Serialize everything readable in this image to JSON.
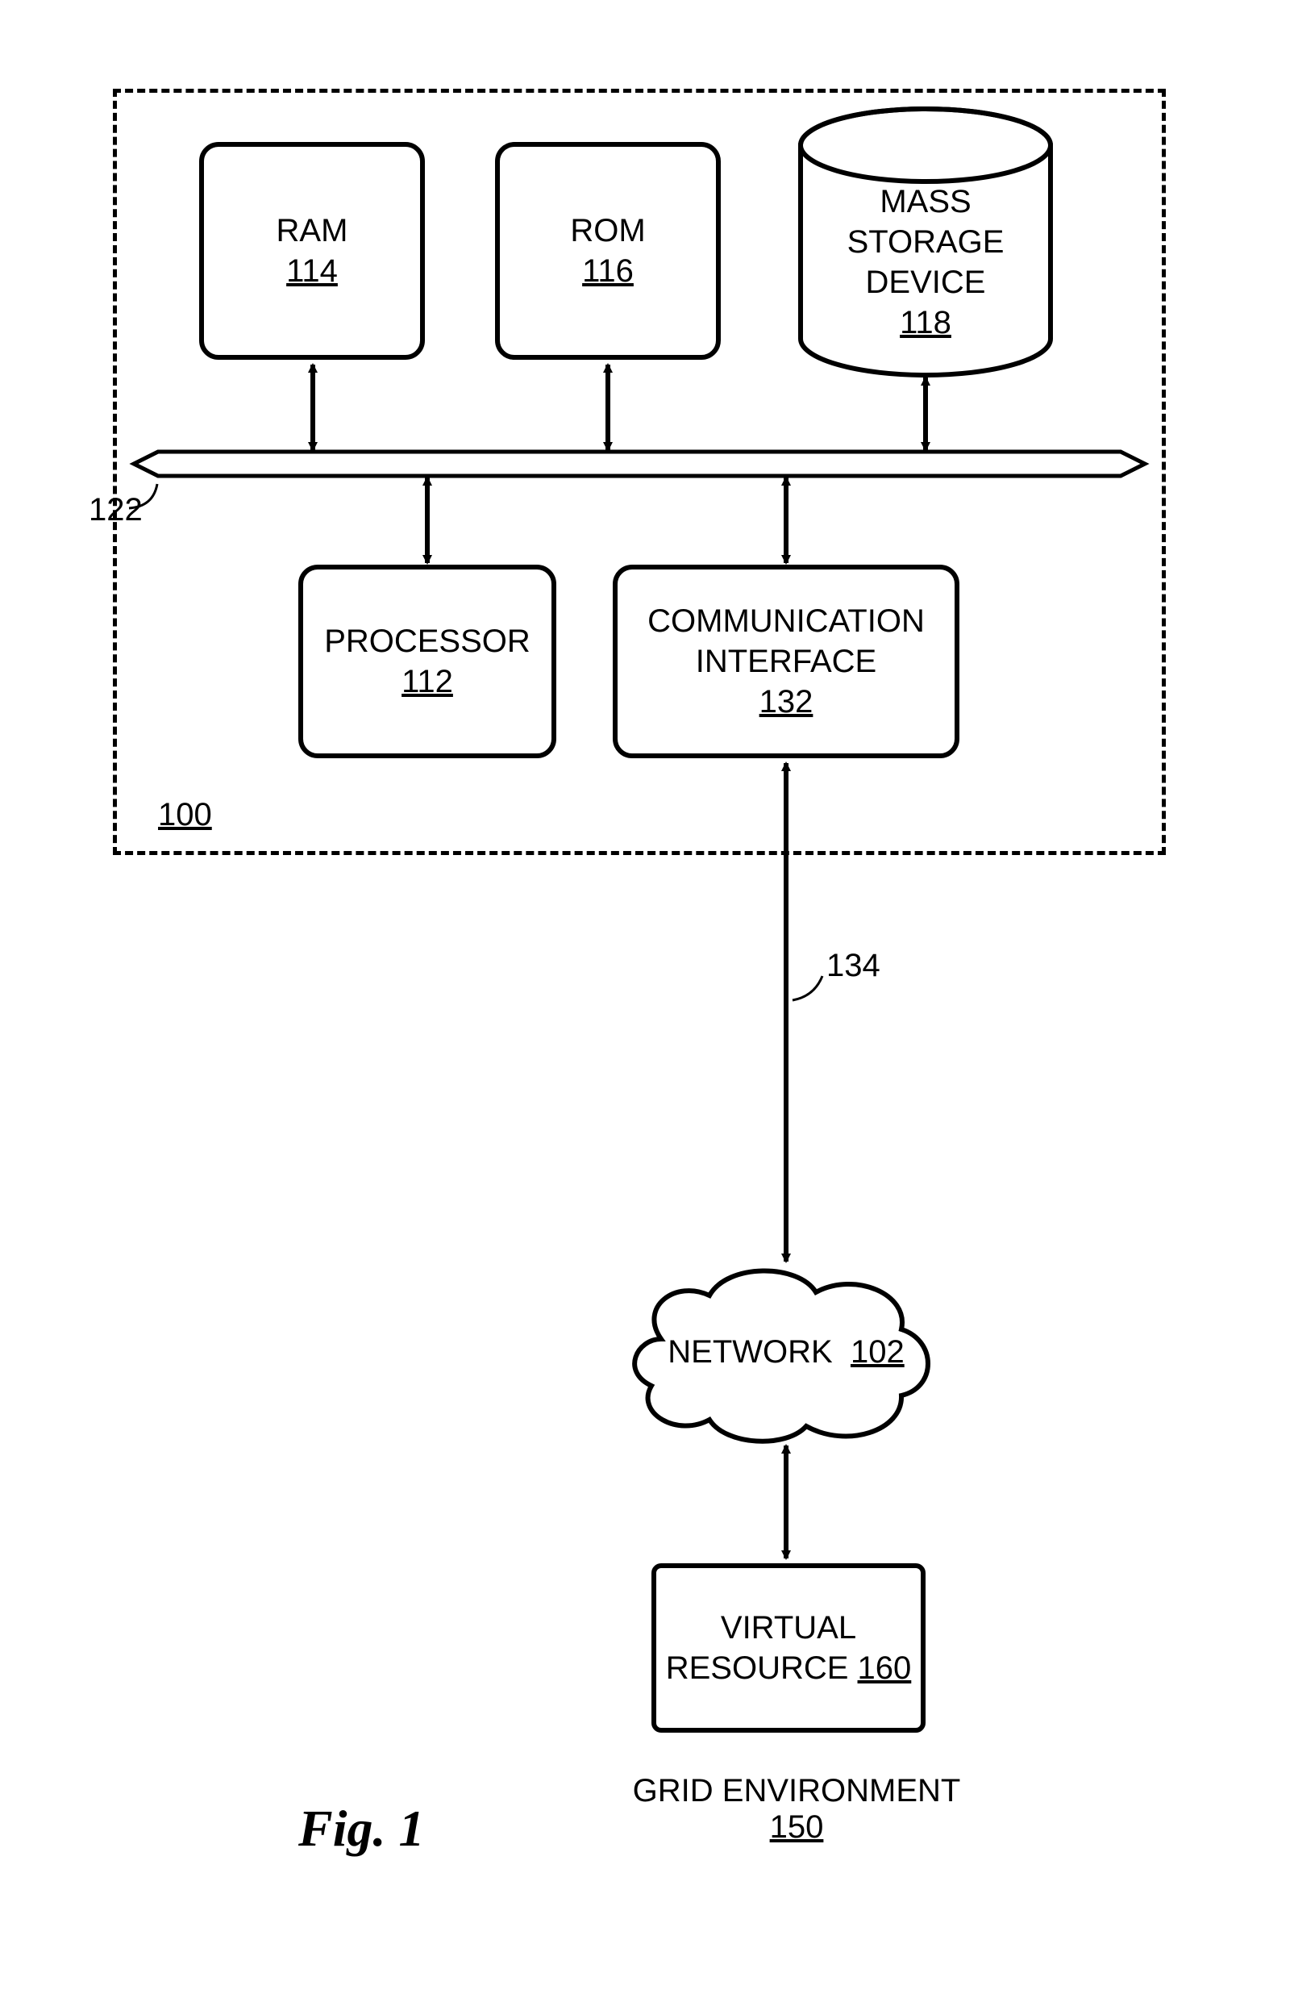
{
  "computer": {
    "ref": "100",
    "bus_ref": "122",
    "ram": {
      "label": "RAM",
      "ref": "114"
    },
    "rom": {
      "label": "ROM",
      "ref": "116"
    },
    "storage": {
      "line1": "MASS",
      "line2": "STORAGE",
      "line3": "DEVICE",
      "ref": "118"
    },
    "processor": {
      "label": "PROCESSOR",
      "ref": "112"
    },
    "comm": {
      "line1": "COMMUNICATION",
      "line2": "INTERFACE",
      "ref": "132"
    }
  },
  "link": {
    "ref": "134"
  },
  "grid": {
    "label": "GRID ENVIRONMENT",
    "ref": "150",
    "network": {
      "label": "NETWORK",
      "ref": "102"
    },
    "vres": {
      "line1": "VIRTUAL",
      "line2": "RESOURCE",
      "ref": "160"
    }
  },
  "caption": "Fig. 1"
}
